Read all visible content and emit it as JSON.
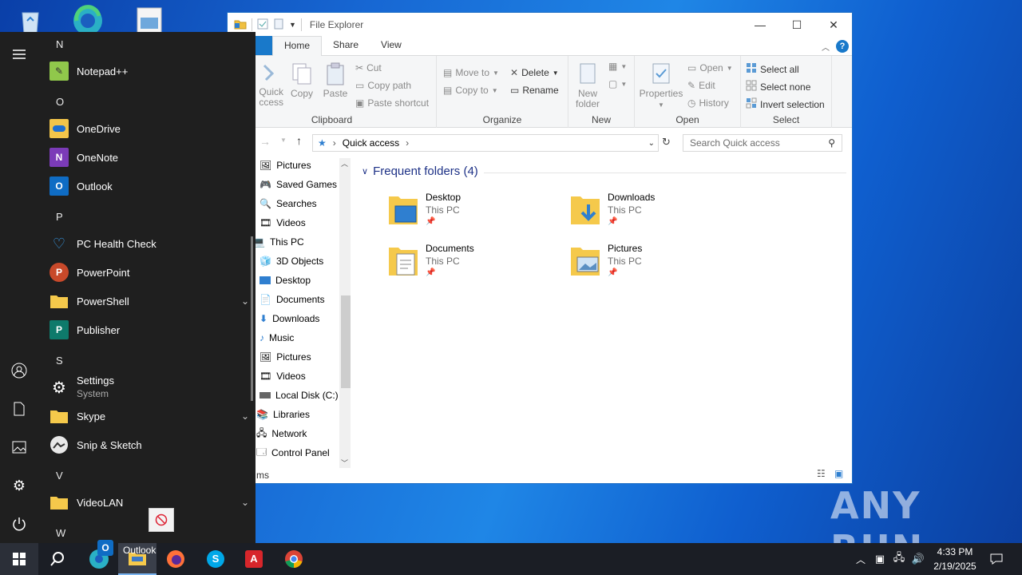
{
  "explorer": {
    "title": "File Explorer",
    "tabs": {
      "home": "Home",
      "share": "Share",
      "view": "View"
    },
    "ribbon": {
      "clipboard": {
        "label": "Clipboard",
        "quick_access_line1": "Quick",
        "quick_access_line2": "ccess",
        "copy": "Copy",
        "paste": "Paste",
        "cut": "Cut",
        "copy_path": "Copy path",
        "paste_shortcut": "Paste shortcut"
      },
      "organize": {
        "label": "Organize",
        "move_to": "Move to",
        "copy_to": "Copy to",
        "delete": "Delete",
        "rename": "Rename"
      },
      "new": {
        "label": "New",
        "new_folder_line1": "New",
        "new_folder_line2": "folder"
      },
      "open": {
        "label": "Open",
        "properties": "Properties",
        "open": "Open",
        "edit": "Edit",
        "history": "History"
      },
      "select": {
        "label": "Select",
        "select_all": "Select all",
        "select_none": "Select none",
        "invert_selection": "Invert selection"
      }
    },
    "address": {
      "path": "Quick access",
      "search_placeholder": "Search Quick access"
    },
    "nav_items": [
      "Pictures",
      "Saved Games",
      "Searches",
      "Videos",
      "This PC",
      "3D Objects",
      "Desktop",
      "Documents",
      "Downloads",
      "Music",
      "Pictures",
      "Videos",
      "Local Disk (C:)",
      "Libraries",
      "Network",
      "Control Panel"
    ],
    "frequent_header": "Frequent folders (4)",
    "folders": [
      {
        "name": "Desktop",
        "location": "This PC"
      },
      {
        "name": "Downloads",
        "location": "This PC"
      },
      {
        "name": "Documents",
        "location": "This PC"
      },
      {
        "name": "Pictures",
        "location": "This PC"
      }
    ],
    "status": "ms"
  },
  "start_menu": {
    "letters": {
      "n": "N",
      "o": "O",
      "p": "P",
      "s": "S",
      "v": "V",
      "w": "W"
    },
    "apps": {
      "notepadpp": "Notepad++",
      "onedrive": "OneDrive",
      "onenote": "OneNote",
      "outlook": "Outlook",
      "pc_health": "PC Health Check",
      "powerpoint": "PowerPoint",
      "powershell": "PowerShell",
      "publisher": "Publisher",
      "settings": "Settings",
      "settings_sub": "System",
      "skype": "Skype",
      "snip": "Snip & Sketch",
      "videolan": "VideoLAN"
    }
  },
  "taskbar": {
    "tooltip": "Outlook",
    "time": "4:33 PM",
    "date": "2/19/2025"
  },
  "watermark": "ANY RUN",
  "colors": {
    "accent": "#1979ca",
    "start_bg": "#1f1f1f",
    "taskbar_bg": "#1b1e25"
  }
}
